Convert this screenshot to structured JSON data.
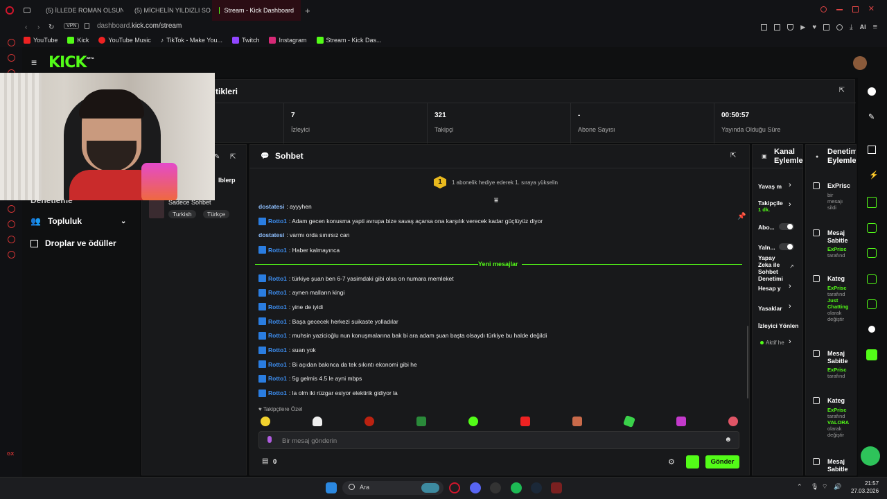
{
  "browser": {
    "tabs": [
      {
        "label": "(5) İLLEDE ROMAN OLSUN"
      },
      {
        "label": "(5) MİCHELİN YILDIZLI SO"
      },
      {
        "label": "Stream - Kick Dashboard"
      }
    ],
    "vpn_label": "VPN",
    "url_domain": "dashboard.",
    "url_rest": "kick.com/stream",
    "ai_label": "AI",
    "bookmarks": [
      "YouTube",
      "Kick",
      "YouTube Music",
      "TikTok - Make You...",
      "Twitch",
      "Instagram",
      "Stream - Kick Das..."
    ]
  },
  "kick": {
    "logo": "KICK",
    "logo_badge": "BETA",
    "nav": {
      "partial": "Denetleme",
      "community": "Topluluk",
      "drops": "Droplar ve ödüller"
    },
    "stats_title": "tikleri",
    "stats": [
      {
        "value": "7",
        "label": "İzleyici"
      },
      {
        "value": "321",
        "label": "Takipçi"
      },
      {
        "value": "-",
        "label": "Abone Sayısı"
      },
      {
        "value": "00:50:57",
        "label": "Yayında Olduğu Süre"
      }
    ],
    "stream_info": {
      "name_partial": "Iblerp",
      "title_partial": "Sadece Sohbet",
      "tags": [
        "Turkish",
        "Türkçe"
      ]
    },
    "chat": {
      "title": "Sohbet",
      "gift_banner": "1 abonelik hediye ederek 1. sıraya yükselin",
      "gift_rank": "1",
      "new_messages_label": "Yeni mesajlar",
      "followers_only": "Takipçilere Özel",
      "input_placeholder": "Bir mesaj gönderin",
      "points": "0",
      "send_button": "Gönder",
      "messages_before": [
        {
          "user": "dostatesi",
          "text": ": ayyyhen",
          "badge": false
        },
        {
          "user": "Rotto1",
          "text": ": Adam gecen konusma yapti avrupa bize savaş açarsa ona karşılık verecek kadar güçlüyüz diyor",
          "badge": true
        },
        {
          "user": "dostatesi",
          "text": ": varmı orda sınırsız can",
          "badge": false
        },
        {
          "user": "Rotto1",
          "text": ": Haber kalmayınca",
          "badge": true
        }
      ],
      "messages_after": [
        {
          "user": "Rotto1",
          "text": ": türkiye şuan ben 6-7 yasimdaki gibi olsa on numara memleket",
          "badge": true
        },
        {
          "user": "Rotto1",
          "text": ": aynen malların kingi",
          "badge": true
        },
        {
          "user": "Rotto1",
          "text": ": yine de iyidi",
          "badge": true
        },
        {
          "user": "Rotto1",
          "text": ": Başa gececek herkezi suikaste yolladılar",
          "badge": true
        },
        {
          "user": "Rotto1",
          "text": ": muhsin yazicioğlu nun konuşmalarına bak bi ara adam şuan başta olsaydı türkiye bu halde değildi",
          "badge": true
        },
        {
          "user": "Rotto1",
          "text": ": suan yok",
          "badge": true
        },
        {
          "user": "Rotto1",
          "text": ": Bi açıdan bakınca da tek sıkıntı ekonomi gibi he",
          "badge": true
        },
        {
          "user": "Rotto1",
          "text": ": 5g gelmis 4.5 le ayni mbps",
          "badge": true
        },
        {
          "user": "Rotto1",
          "text": ": la olm iki rüzgar esiyor elektirik gidiyor la",
          "badge": true
        }
      ]
    },
    "channel_actions": {
      "title_line1": "Kanal",
      "title_line2": "Eylemle",
      "items": [
        "Yavaş m",
        "Takipçile",
        "Abo...",
        "Yaln...",
        "Yapay Zeka ile Sohbet Denetimi",
        "Hesap y",
        "Yasaklar",
        "İzleyici Yönlen",
        "Aktif he"
      ],
      "follower_sub": "1 dk."
    },
    "mod_actions": {
      "title_line1": "Denetim",
      "title_line2": "Eylemle",
      "entries": [
        {
          "title": "ExPrisc",
          "lines": [
            "bir",
            "mesajı",
            "sildi"
          ]
        },
        {
          "title": "Mesaj Sabitle",
          "lines": [
            "ExPrisc",
            "tarafınd"
          ]
        },
        {
          "title": "Kateg",
          "lines": [
            "ExPrisc",
            "tarafınd",
            "Just",
            "Chatting",
            "olarak",
            "değiştir"
          ]
        },
        {
          "title": "Mesaj Sabitle",
          "lines": [
            "ExPrisc",
            "tarafınd"
          ]
        },
        {
          "title": "Kateg",
          "lines": [
            "ExPrisc",
            "tarafınd",
            "VALORA",
            "olarak",
            "değiştir"
          ]
        },
        {
          "title": "Mesaj Sabitle",
          "lines": []
        }
      ]
    }
  },
  "taskbar": {
    "search": "Ara",
    "time": "21:57",
    "date": "27.03.2026"
  },
  "colors": {
    "kick_green": "#53fc18",
    "opera_red": "#d0162c",
    "badge_blue": "#2a7de1"
  }
}
